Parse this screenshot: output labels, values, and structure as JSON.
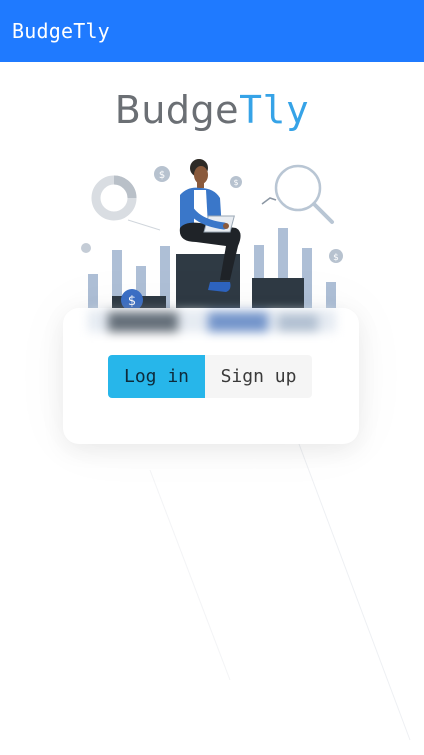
{
  "appbar": {
    "title": "BudgeTly"
  },
  "brand": {
    "part1": "Budge",
    "part2": "Tly"
  },
  "auth": {
    "login_label": "Log in",
    "signup_label": "Sign up",
    "selected": "Log in"
  },
  "illustration": {
    "icons": [
      "dollar-coin-icon",
      "pie-chart-icon",
      "magnifier-icon",
      "laptop-icon"
    ]
  },
  "colors": {
    "appbar": "#1f7aff",
    "accent": "#27b6ea",
    "brand_gray": "#6b6f74",
    "brand_blue": "#36a3e7"
  }
}
